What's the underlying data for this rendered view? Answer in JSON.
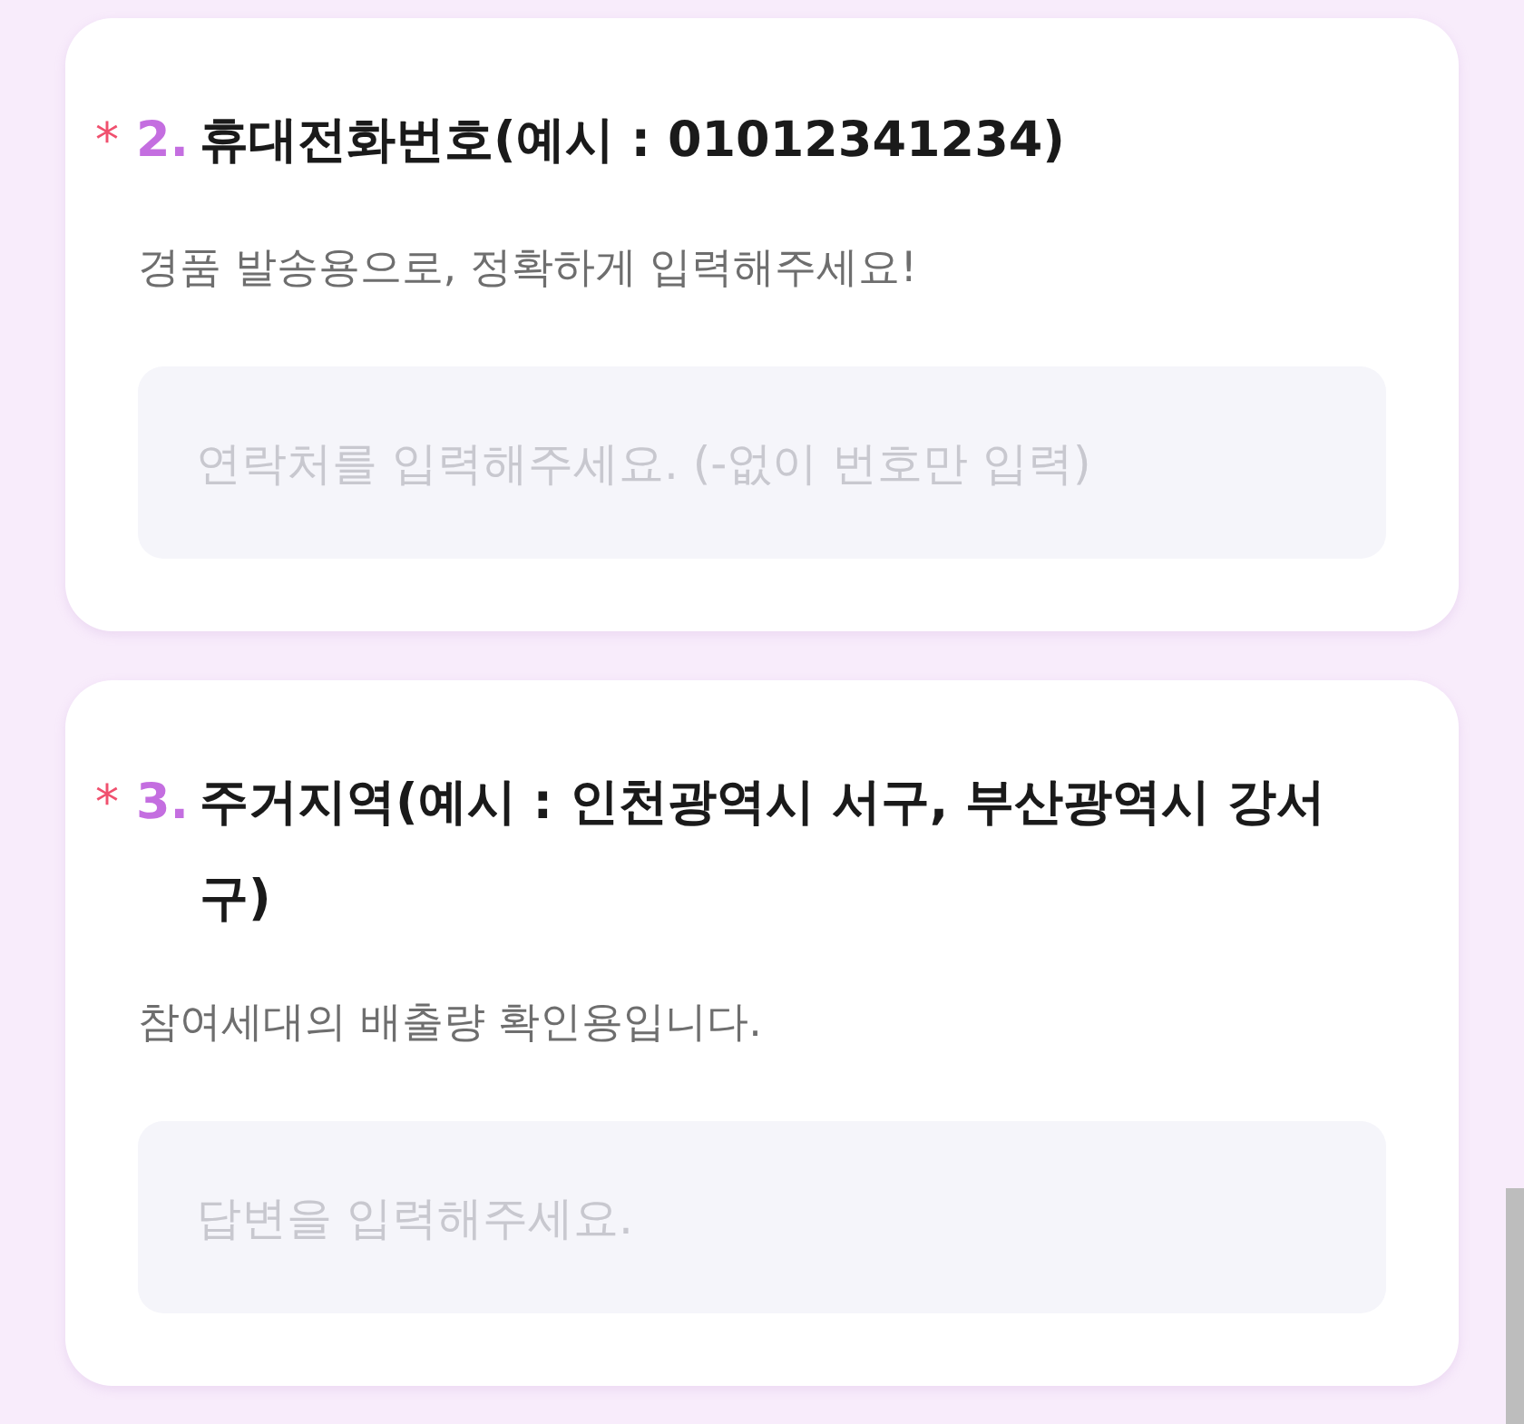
{
  "questions": [
    {
      "mark": "*",
      "number": "2.",
      "title": "휴대전화번호(예시 : 01012341234)",
      "description": "경품 발송용으로, 정확하게 입력해주세요!",
      "placeholder": "연락처를 입력해주세요. (-없이 번호만 입력)"
    },
    {
      "mark": "*",
      "number": "3.",
      "title": "주거지역(예시 : 인천광역시 서구, 부산광역시 강서구)",
      "description": "참여세대의 배출량 확인용입니다.",
      "placeholder": "답변을 입력해주세요."
    }
  ]
}
